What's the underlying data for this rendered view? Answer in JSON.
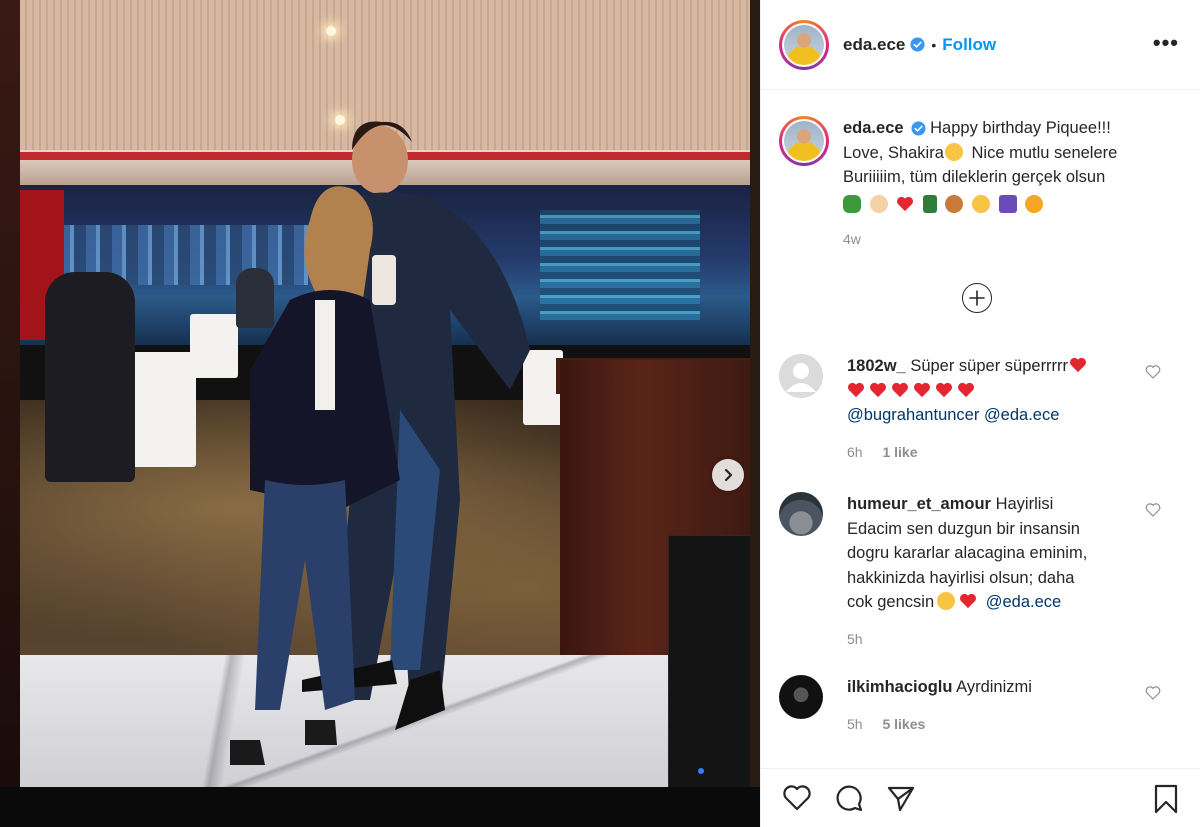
{
  "post": {
    "username": "eda.ece",
    "follow_label": "Follow",
    "separator": "•",
    "more_label": "•••"
  },
  "caption": {
    "username": "eda.ece",
    "line1": "Happy birthday Piquee!!!",
    "line2": "Love, Shakira",
    "line3": "Nice mutlu senelere",
    "line4": "Buriiiiim, tüm dileklerin gerçek olsun",
    "time": "4w"
  },
  "comments": [
    {
      "username": "1802w_",
      "text": "Süper süper süperrrrr",
      "mention1": "@bugrahantuncer",
      "mention2": "@eda.ece",
      "time": "6h",
      "likes": "1 like"
    },
    {
      "username": "humeur_et_amour",
      "line1": "Hayirlisi",
      "line2": "Edacim sen duzgun bir insansin",
      "line3": "dogru kararlar alacagina eminim,",
      "line4": "hakkinizda hayirlisi olsun; daha",
      "line5": "cok gencsin",
      "mention": "@eda.ece",
      "time": "5h"
    },
    {
      "username": "ilkimhacioglu",
      "text": "Ayrdinizmi",
      "time": "5h",
      "likes": "5 likes"
    }
  ],
  "colors": {
    "link_blue": "#0095f6",
    "mention_blue": "#00376b",
    "heart_red": "#e3262f",
    "muted": "#8e8e8e"
  },
  "icons": [
    "verified-badge-icon",
    "more-options-icon",
    "next-photo-icon",
    "load-more-icon",
    "like-icon",
    "comment-icon",
    "share-icon",
    "save-icon",
    "heart-icon"
  ]
}
